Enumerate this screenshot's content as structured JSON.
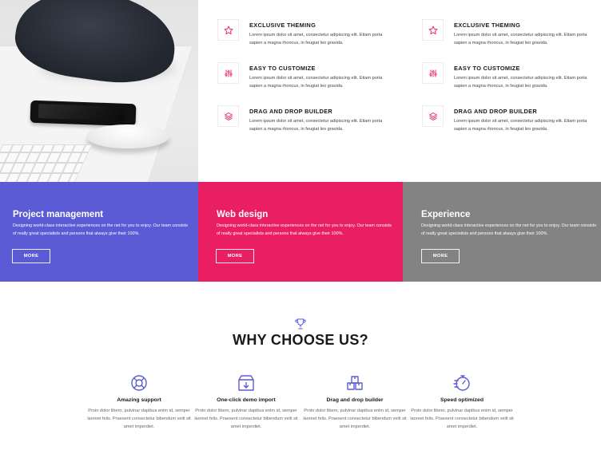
{
  "features": {
    "left": [
      {
        "icon": "star-icon",
        "title": "EXCLUSIVE THEMING",
        "text": "Lorem ipsum dolor sit amet, consectetur adipiscing elit. Etiam porta sapien a magna rhoncus, in feugiat leo gravida."
      },
      {
        "icon": "sliders-icon",
        "title": "EASY TO CUSTOMIZE",
        "text": "Lorem ipsum dolor sit amet, consectetur adipiscing elit. Etiam porta sapien a magna rhoncus, in feugiat leo gravida."
      },
      {
        "icon": "layers-icon",
        "title": "DRAG AND DROP BUILDER",
        "text": "Lorem ipsum dolor sit amet, consectetur adipiscing elit. Etiam porta sapien a magna rhoncus, in feugiat leo gravida."
      }
    ],
    "right": [
      {
        "icon": "star-icon",
        "title": "EXCLUSIVE THEMING",
        "text": "Lorem ipsum dolor sit amet, consectetur adipiscing elit. Etiam porta sapien a magna rhoncus, in feugiat leo gravida."
      },
      {
        "icon": "sliders-icon",
        "title": "EASY TO CUSTOMIZE",
        "text": "Lorem ipsum dolor sit amet, consectetur adipiscing elit. Etiam porta sapien a magna rhoncus, in feugiat leo gravida."
      },
      {
        "icon": "layers-icon",
        "title": "DRAG AND DROP BUILDER",
        "text": "Lorem ipsum dolor sit amet, consectetur adipiscing elit. Etiam porta sapien a magna rhoncus, in feugiat leo gravida."
      }
    ],
    "icon_color": "#e8215f"
  },
  "panels": [
    {
      "title": "Project management",
      "text": "Designing world-class interactive experiences on the net for you to enjoy. Our team consists of really great specialists and persons that always give their 100%.",
      "button": "MORE",
      "color": "#5b5bd6"
    },
    {
      "title": "Web design",
      "text": "Designing world-class interactive experiences on the net for you to enjoy. Our team consists of really great specialists and persons that always give their 100%.",
      "button": "MORE",
      "color": "#e91e63"
    },
    {
      "title": "Experience",
      "text": "Designing world-class interactive experiences on the net for you to enjoy. Our team consists of really great specialists and persons that always give their 100%.",
      "button": "MORE",
      "color": "#838383"
    }
  ],
  "why": {
    "icon": "trophy-icon",
    "title": "WHY CHOOSE US?",
    "accent": "#5b5bd6",
    "items": [
      {
        "icon": "lifebuoy-icon",
        "title": "Amazing support",
        "text": "Proin dolor libero, pulvinar dapibus enim id, semper laoreet felis. Praesent consectetur bibendum velit sit amet imperdiet."
      },
      {
        "icon": "box-download-icon",
        "title": "One-click demo import",
        "text": "Proin dolor libero, pulvinar dapibus enim id, semper laoreet felis. Praesent consectetur bibendum velit sit amet imperdiet."
      },
      {
        "icon": "boxes-icon",
        "title": "Drag and drop builder",
        "text": "Proin dolor libero, pulvinar dapibus enim id, semper laoreet felis. Praesent consectetur bibendum velit sit amet imperdiet."
      },
      {
        "icon": "stopwatch-icon",
        "title": "Speed optimized",
        "text": "Proin dolor libero, pulvinar dapibus enim id, semper laoreet felis. Praesent consectetur bibendum velit sit amet imperdiet."
      }
    ]
  }
}
